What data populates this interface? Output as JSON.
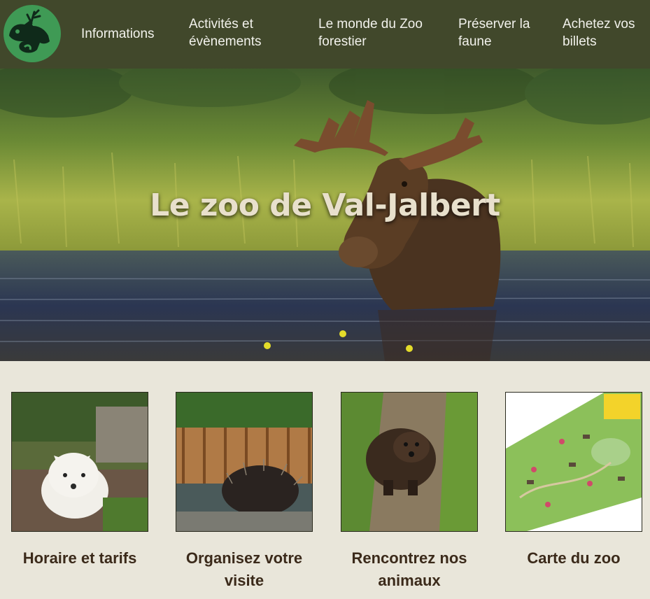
{
  "nav": {
    "logo_alt": "Zoo de Val-Jalbert",
    "items": [
      {
        "label": "Informations"
      },
      {
        "label": "Activités et évènements"
      },
      {
        "label": "Le monde du Zoo forestier"
      },
      {
        "label": "Préserver la faune"
      },
      {
        "label": "Achetez vos billets"
      }
    ]
  },
  "hero": {
    "title": "Le zoo de Val-Jalbert",
    "image": "moose-in-water-photo"
  },
  "cards": [
    {
      "label": "Horaire et tarifs",
      "image": "arctic-fox-photo"
    },
    {
      "label": "Organisez votre visite",
      "image": "porcupine-photo"
    },
    {
      "label": "Rencontrez nos animaux",
      "image": "wolverine-photo"
    },
    {
      "label": "Carte du zoo",
      "image": "zoo-map-illustration"
    }
  ],
  "colors": {
    "nav_bg": "#41482b",
    "logo_green": "#3f9a55",
    "page_bg": "#e9e6da",
    "card_text": "#3b2a1a"
  }
}
